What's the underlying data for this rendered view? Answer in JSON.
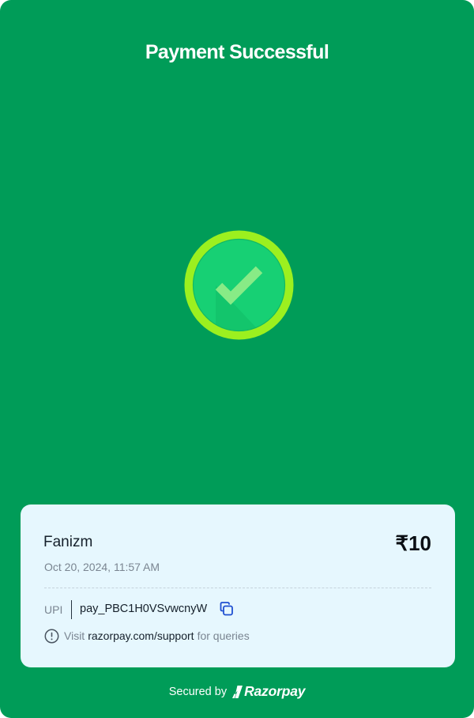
{
  "header": {
    "title": "Payment Successful"
  },
  "status": {
    "icon": "check-circle-icon",
    "colors": {
      "background": "#009c58",
      "ring": "#9cf01f",
      "disc": "#17d074",
      "check": "#88eb86"
    }
  },
  "payment": {
    "merchant": "Fanizm",
    "amount": "₹10",
    "datetime": "Oct 20, 2024, 11:57 AM",
    "method": "UPI",
    "payment_id": "pay_PBC1H0VSvwcnyW",
    "copy_icon": "copy-icon"
  },
  "support": {
    "icon": "info-icon",
    "prefix": "Visit",
    "link": "razorpay.com/support",
    "suffix": "for queries"
  },
  "footer": {
    "secured_by": "Secured by",
    "brand": "Razorpay",
    "brand_icon": "razorpay-logo-icon"
  }
}
